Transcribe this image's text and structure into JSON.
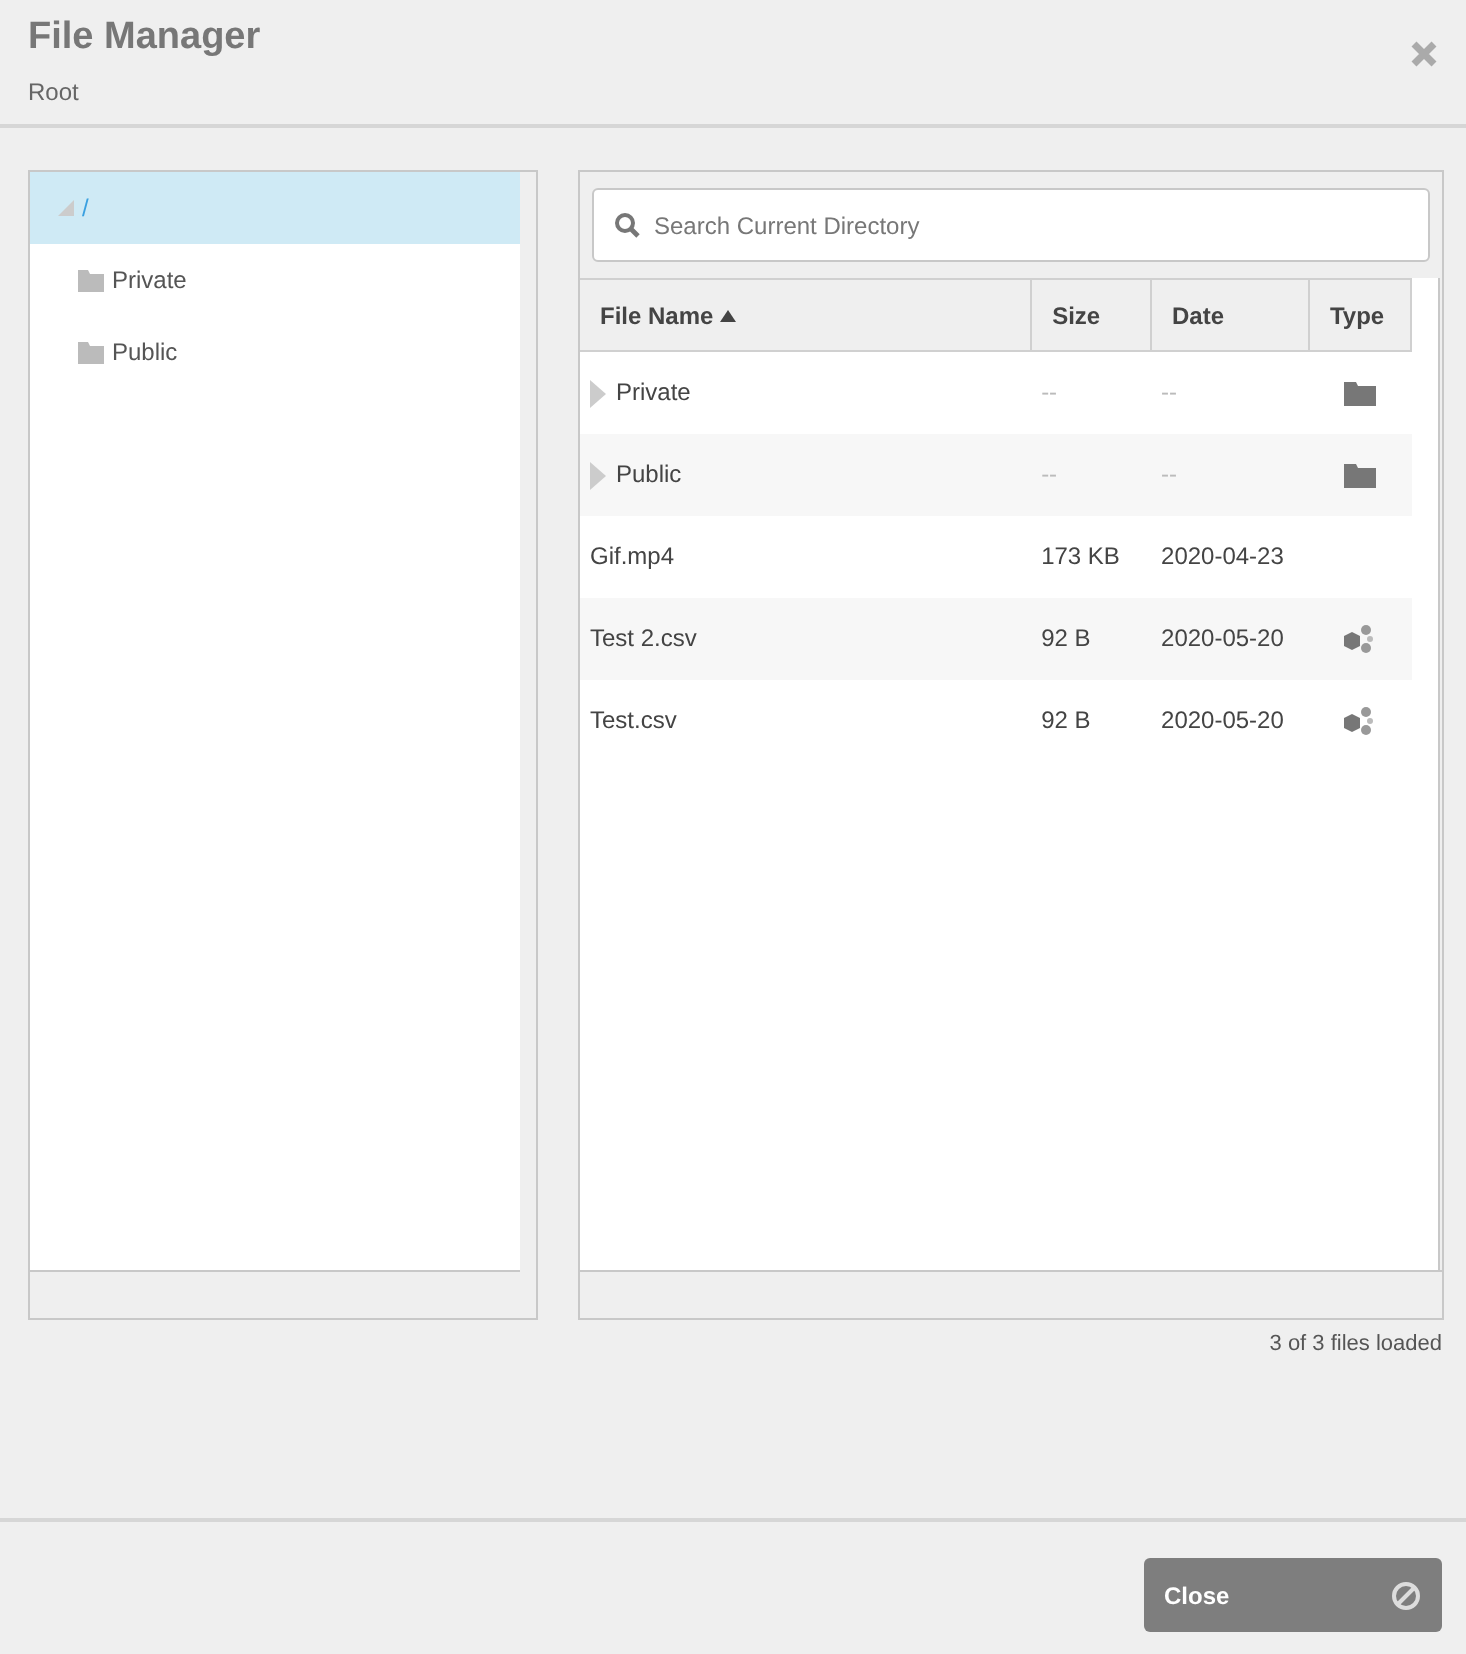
{
  "dialog": {
    "title": "File Manager",
    "subtitle": "Root"
  },
  "tree": [
    {
      "label": "/",
      "selected": true,
      "expanded": true,
      "children": [
        {
          "label": "Private",
          "selected": false
        },
        {
          "label": "Public",
          "selected": false
        }
      ]
    }
  ],
  "search": {
    "placeholder": "Search Current Directory"
  },
  "table": {
    "columns": [
      {
        "label": "File Name",
        "sorted": true
      },
      {
        "label": "Size",
        "sorted": false
      },
      {
        "label": "Date",
        "sorted": false
      },
      {
        "label": "Type",
        "sorted": false
      }
    ],
    "rows": [
      {
        "kind": "folder",
        "name": "Private",
        "size": "--",
        "date": "--"
      },
      {
        "kind": "folder",
        "name": "Public",
        "size": "--",
        "date": "--"
      },
      {
        "kind": "video",
        "name": "Gif.mp4",
        "size": "173 KB",
        "date": "2020-04-23"
      },
      {
        "kind": "dataset",
        "name": "Test 2.csv",
        "size": "92 B",
        "date": "2020-05-20"
      },
      {
        "kind": "dataset",
        "name": "Test.csv",
        "size": "92 B",
        "date": "2020-05-20"
      }
    ]
  },
  "status": "3 of 3 files loaded",
  "buttons": [
    {
      "label": "Close"
    }
  ]
}
